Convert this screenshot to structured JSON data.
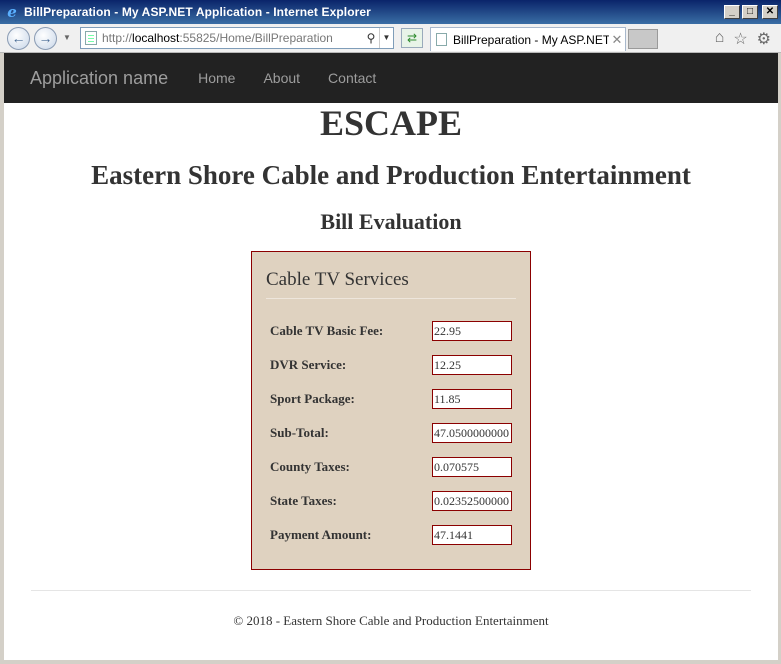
{
  "window": {
    "title": "BillPreparation - My ASP.NET Application - Internet Explorer",
    "min_symbol": "_",
    "max_symbol": "□",
    "close_symbol": "✕"
  },
  "browser": {
    "url_prefix": "http://",
    "url_host": "localhost",
    "url_rest": ":55825/Home/BillPreparation",
    "tab_label": "BillPreparation - My ASP.NET...",
    "tab_close": "✕",
    "icons": [
      "ie-logo-icon",
      "back-arrow-icon",
      "forward-arrow-icon",
      "search-icon",
      "refresh-icon",
      "home-icon",
      "favorites-star-icon",
      "settings-gear-icon"
    ]
  },
  "navbar": {
    "brand": "Application name",
    "links": [
      "Home",
      "About",
      "Contact"
    ]
  },
  "header": {
    "acronym": "ESCAPE",
    "company": "Eastern Shore Cable and Production Entertainment",
    "page_heading": "Bill Evaluation"
  },
  "bill": {
    "title": "Cable TV Services",
    "rows": [
      {
        "label": "Cable TV Basic Fee:",
        "value": "22.95"
      },
      {
        "label": "DVR Service:",
        "value": "12.25"
      },
      {
        "label": "Sport Package:",
        "value": "11.85"
      },
      {
        "label": "Sub-Total:",
        "value": "47.0500000000"
      },
      {
        "label": "County Taxes:",
        "value": "0.070575"
      },
      {
        "label": "State Taxes:",
        "value": "0.02352500000"
      },
      {
        "label": "Payment Amount:",
        "value": "47.1441"
      }
    ]
  },
  "footer": {
    "text": "© 2018 - Eastern Shore Cable and Production Entertainment"
  },
  "colors": {
    "navbar_bg": "#222222",
    "box_bg": "#dfd2c0",
    "box_border": "#8b0000"
  }
}
